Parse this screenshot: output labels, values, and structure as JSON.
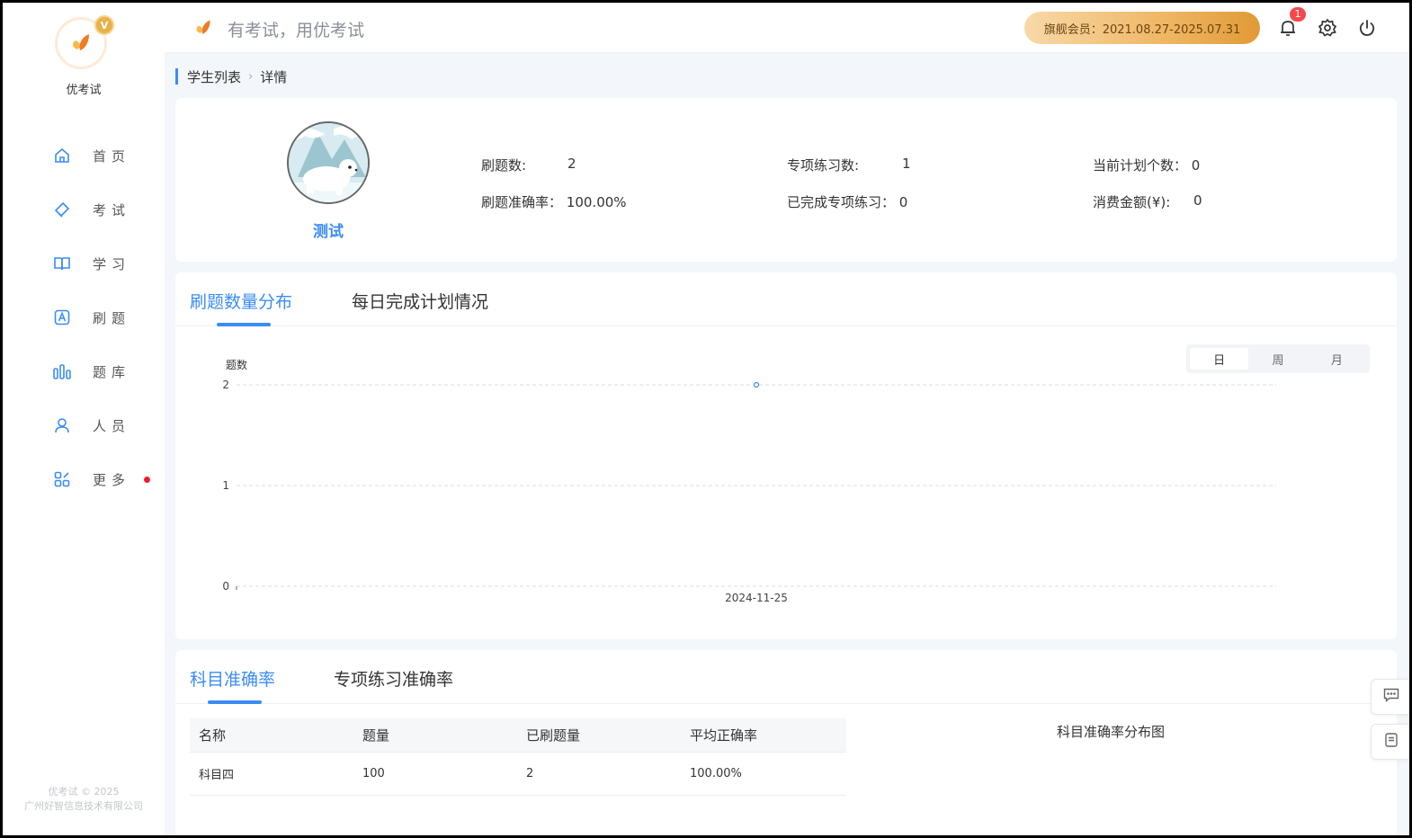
{
  "brand": {
    "name": "优考试",
    "vip_mark": "V"
  },
  "header": {
    "slogan": "有考试，用优考试",
    "member": "旗舰会员：2021.08.27-2025.07.31",
    "notification_count": "1"
  },
  "nav": [
    {
      "label": "首页",
      "icon": "home-icon"
    },
    {
      "label": "考试",
      "icon": "eraser-icon"
    },
    {
      "label": "学习",
      "icon": "book-icon"
    },
    {
      "label": "刷题",
      "icon": "letter-a-icon"
    },
    {
      "label": "题库",
      "icon": "bars-icon"
    },
    {
      "label": "人员",
      "icon": "user-icon"
    },
    {
      "label": "更多",
      "icon": "apps-icon"
    }
  ],
  "copyright": {
    "line1": "优考试 © 2025",
    "line2": "广州好智信息技术有限公司"
  },
  "breadcrumb": {
    "parent": "学生列表",
    "current": "详情",
    "separator": "›"
  },
  "profile": {
    "name": "测试",
    "stats": {
      "practice_count": {
        "label": "刷题数:",
        "value": "2"
      },
      "special_count": {
        "label": "专项练习数:",
        "value": "1"
      },
      "plan_count": {
        "label": "当前计划个数：",
        "value": "0"
      },
      "accuracy": {
        "label": "刷题准确率：",
        "value": "100.00%"
      },
      "special_done": {
        "label": "已完成专项练习：",
        "value": "0"
      },
      "spend": {
        "label": "消费金额(¥):",
        "value": "0"
      }
    }
  },
  "chart_tabs": {
    "tab1": "刷题数量分布",
    "tab2": "每日完成计划情况"
  },
  "period_switch": {
    "day": "日",
    "week": "周",
    "month": "月",
    "selected": "日"
  },
  "chart_data": {
    "type": "line",
    "ylabel": "题数",
    "xlabel": "",
    "ylim": [
      0,
      2
    ],
    "yticks": [
      "0",
      "1",
      "2"
    ],
    "categories": [
      "2024-11-25"
    ],
    "series": [
      {
        "values": [
          2
        ]
      }
    ],
    "grid": true,
    "accent": "#3b8cf5"
  },
  "accuracy_tabs": {
    "tab1": "科目准确率",
    "tab2": "专项练习准确率"
  },
  "accuracy_table": {
    "headers": [
      "名称",
      "题量",
      "已刷题量",
      "平均正确率"
    ],
    "rows": [
      [
        "科目四",
        "100",
        "2",
        "100.00%"
      ]
    ]
  },
  "pie_title": "科目准确率分布图",
  "colors": {
    "accent": "#3b8cf5",
    "gold": "#efb664",
    "red": "#ee1f2a"
  }
}
